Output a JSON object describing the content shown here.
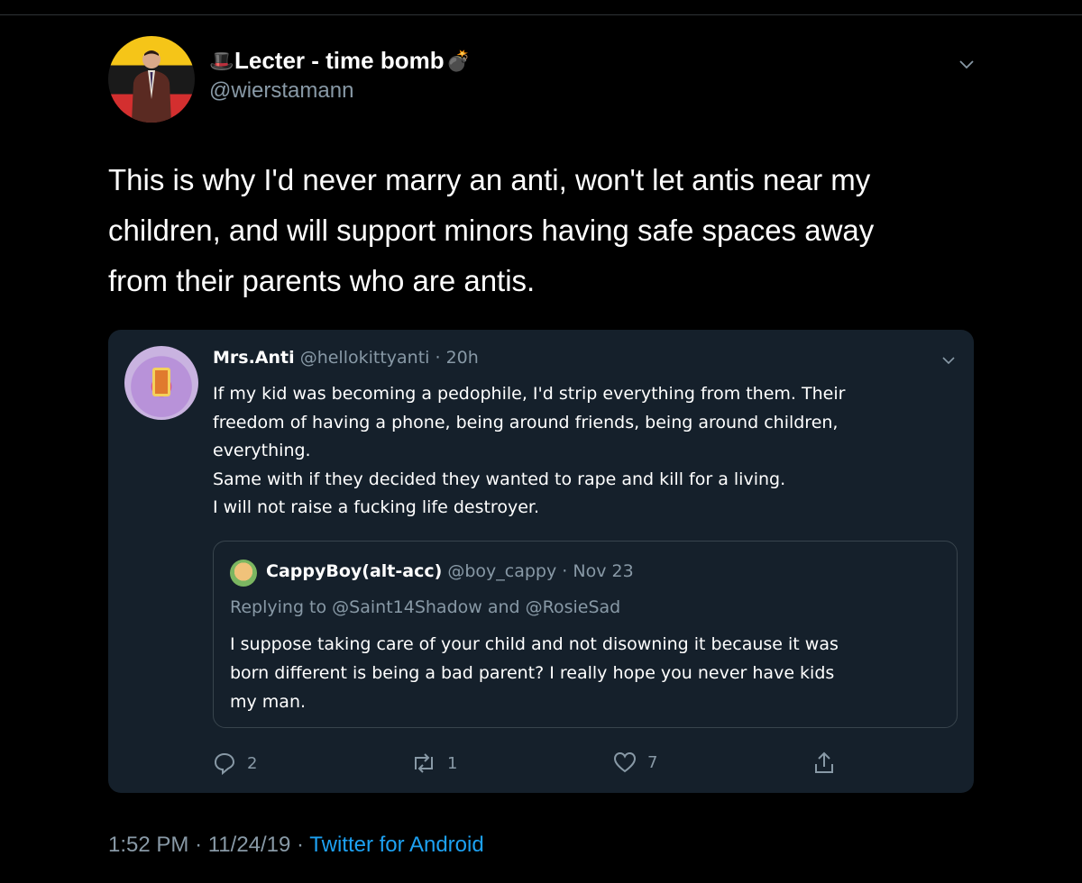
{
  "tweet": {
    "display_name": "Lecter - time bomb",
    "name_icons": [
      "top-hat-icon",
      "bomb-icon"
    ],
    "handle": "@wierstamann",
    "text_lines": [
      "This is why I'd never marry an anti, won't let antis near my",
      "children, and will support minors having safe spaces away",
      "from their parents who are antis."
    ],
    "time": "1:52 PM",
    "date": "11/24/19",
    "separator": "·",
    "source": "Twitter for Android"
  },
  "quoted": {
    "name": "Mrs.Anti",
    "handle": "@hellokittyanti",
    "separator": "·",
    "time": "20h",
    "text_lines": [
      "If my kid was becoming a pedophile, I'd strip everything from them. Their",
      "freedom of having a phone, being around friends, being around children,",
      "everything.",
      "Same with if they decided they wanted to rape and kill for a living.",
      "I will not raise a fucking life destroyer."
    ],
    "nested": {
      "name": "CappyBoy(alt-acc)",
      "handle": "@boy_cappy",
      "separator": "·",
      "date": "Nov 23",
      "replying_prefix": "Replying to",
      "reply_user1": "@Saint14Shadow",
      "reply_and": "and",
      "reply_user2": "@RosieSad",
      "text_lines": [
        "I suppose taking care of your child and not disowning it because it was",
        "born different is being a bad parent? I really hope you never have kids",
        "my man."
      ]
    },
    "actions": {
      "reply_count": "2",
      "retweet_count": "1",
      "like_count": "7"
    }
  },
  "colors": {
    "background": "#000000",
    "card": "#15202b",
    "muted": "#8899a6",
    "link": "#1da1f2"
  }
}
